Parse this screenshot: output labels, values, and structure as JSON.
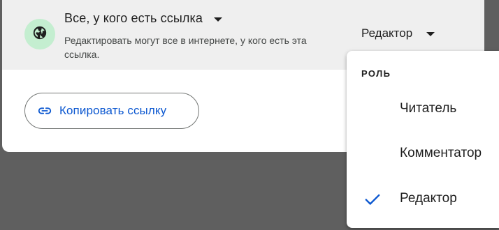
{
  "share_dialog": {
    "general_access": {
      "title": "Все, у кого есть ссылка",
      "description": "Редактировать могут все в интернете, у кого есть эта ссылка.",
      "role": "Редактор",
      "icon": "globe-icon"
    },
    "copy_link": {
      "label": "Копировать ссылку",
      "icon": "link-icon"
    }
  },
  "role_menu": {
    "header": "Роль",
    "items": [
      {
        "label": "Читатель",
        "selected": false
      },
      {
        "label": "Комментатор",
        "selected": false
      },
      {
        "label": "Редактор",
        "selected": true
      }
    ]
  },
  "colors": {
    "accent": "#0b57d0",
    "globe_bg": "#c4eed0",
    "backdrop": "#5f5f5f"
  }
}
